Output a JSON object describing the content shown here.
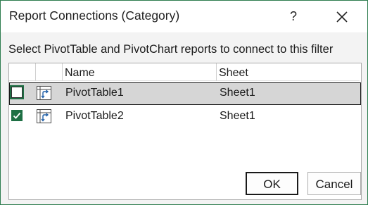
{
  "window": {
    "title": "Report Connections (Category)",
    "help_label": "?",
    "close_icon": "close-icon"
  },
  "instruction": "Select PivotTable and PivotChart reports to connect to this filter",
  "list": {
    "columns": [
      "",
      "Name",
      "Sheet"
    ],
    "rows": [
      {
        "checked": false,
        "icon": "pivottable-icon",
        "name": "PivotTable1",
        "sheet": "Sheet1",
        "selected": true
      },
      {
        "checked": true,
        "icon": "pivottable-icon",
        "name": "PivotTable2",
        "sheet": "Sheet1",
        "selected": false
      }
    ]
  },
  "buttons": {
    "ok_label": "OK",
    "cancel_label": "Cancel"
  },
  "colors": {
    "accent": "#1e6f44",
    "frame": "#2e7d4f",
    "selection": "#d6d6d6"
  }
}
